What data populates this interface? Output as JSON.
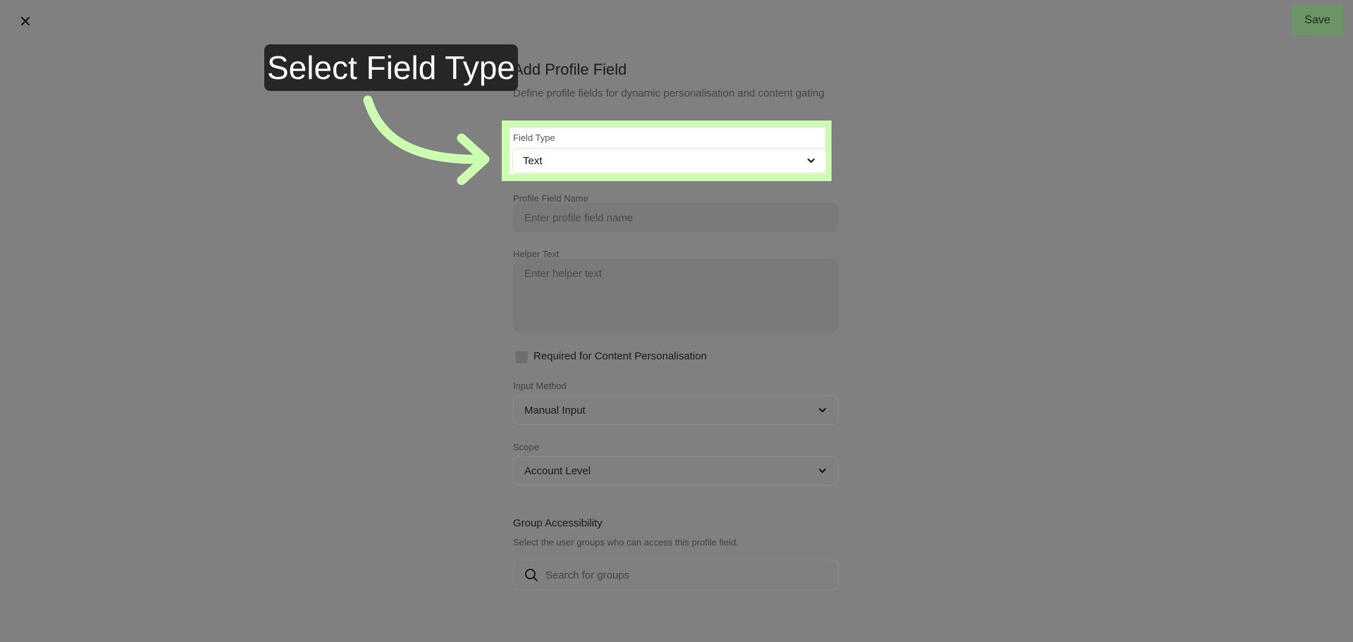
{
  "header": {
    "close_icon": "close-icon",
    "save_label": "Save"
  },
  "form": {
    "title": "Add Profile Field",
    "subtitle": "Define profile fields for dynamic personalisation and content gating",
    "field_type": {
      "label": "Field Type",
      "value": "Text"
    },
    "profile_field_name": {
      "label": "Profile Field Name",
      "placeholder": "Enter profile field name"
    },
    "helper_text": {
      "label": "Helper Text",
      "placeholder": "Enter helper text"
    },
    "required": {
      "label": "Required for Content Personalisation",
      "checked": false
    },
    "input_method": {
      "label": "Input Method",
      "value": "Manual Input"
    },
    "scope": {
      "label": "Scope",
      "value": "Account Level"
    },
    "group_accessibility": {
      "title": "Group Accessibility",
      "description": "Select the user groups who can access this profile field.",
      "search_placeholder": "Search for groups"
    }
  },
  "tutorial": {
    "callout_text": "Select Field Type",
    "highlight_color": "#cdfdb1",
    "callout_bg": "#262626"
  },
  "colors": {
    "overlay": "#808080",
    "save_button": "#6b9467"
  }
}
